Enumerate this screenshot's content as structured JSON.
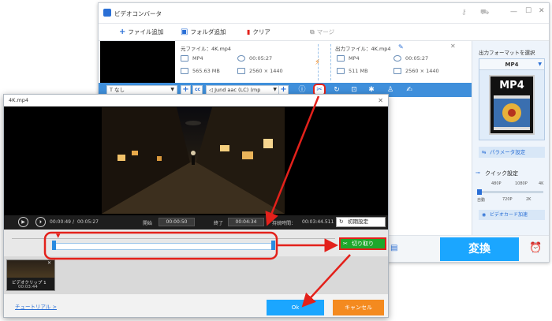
{
  "main": {
    "app_title": "ビデオコンバータ",
    "toolbar": {
      "add_file": "ファイル追加",
      "add_folder": "フォルダ追加",
      "clear": "クリア",
      "merge": "マージ"
    },
    "source": {
      "label": "元ファイル：4K.mp4",
      "format": "MP4",
      "duration": "00:05:27",
      "size": "565.63 MB",
      "resolution": "2560 × 1440"
    },
    "output": {
      "label": "出力ファイル：4K.mp4",
      "format": "MP4",
      "duration": "00:05:27",
      "size": "511 MB",
      "resolution": "2560 × 1440"
    },
    "edit_bar": {
      "subtitle": "なし",
      "audio": "Jund aac (LC) (mp"
    },
    "right_panel": {
      "title": "出力フォーマットを選択",
      "format": "MP4",
      "format_icon_label": "MP4",
      "param_button": "パラメータ設定",
      "quick_label": "クイック設定",
      "quality_ticks_top": [
        "480P",
        "1080P",
        "4K"
      ],
      "quality_ticks_bottom": [
        "自動",
        "720P",
        "2K"
      ],
      "gpu_label": "ビデオカード加速"
    },
    "convert": "変換"
  },
  "dialog": {
    "title": "4K.mp4",
    "time_current": "00:00:49",
    "time_total": "00:05:27",
    "start_label": "開始",
    "start_time": "00:00:50",
    "end_label": "終了",
    "end_time": "00:04:34",
    "duration_label": "持続時間：",
    "duration_value": "00:03:44.511",
    "reset": "初期設定",
    "cut": "切り取り",
    "clip_name": "ビデオクリップ 1",
    "clip_duration": "00:03:44",
    "tutorial": "チュートリアル >",
    "ok": "Ok",
    "cancel": "キャンセル"
  },
  "colors": {
    "accent": "#1ba6ff",
    "edit_bar": "#3f8fdb",
    "cut_button": "#1ea82b",
    "cancel": "#f48a1f",
    "annotation": "#e3211b"
  }
}
